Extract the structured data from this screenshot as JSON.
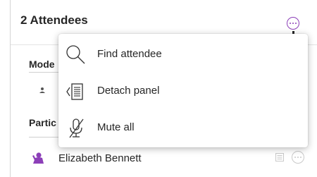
{
  "panel": {
    "title": "2 Attendees"
  },
  "sections": {
    "moderators_label": "Mode",
    "participants_label": "Partic"
  },
  "attendees": [
    {
      "name": "Elizabeth Bennett"
    }
  ],
  "menu": {
    "items": [
      {
        "label": "Find attendee",
        "icon": "search-icon"
      },
      {
        "label": "Detach panel",
        "icon": "detach-panel-icon"
      },
      {
        "label": "Mute all",
        "icon": "microphone-muted-icon"
      }
    ]
  },
  "colors": {
    "accent": "#8c3fb8",
    "text": "#262626",
    "muted": "#c9c9c9"
  }
}
